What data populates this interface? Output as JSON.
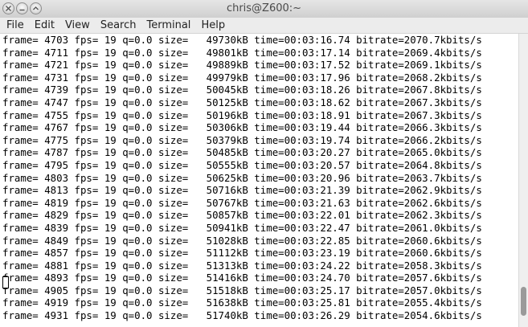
{
  "window": {
    "title": "chris@Z600:~"
  },
  "menu": [
    "File",
    "Edit",
    "View",
    "Search",
    "Terminal",
    "Help"
  ],
  "terminal": {
    "lines": [
      "frame= 4703 fps= 19 q=0.0 size=   49730kB time=00:03:16.74 bitrate=2070.7kbits/s",
      "frame= 4711 fps= 19 q=0.0 size=   49801kB time=00:03:17.14 bitrate=2069.4kbits/s",
      "frame= 4721 fps= 19 q=0.0 size=   49889kB time=00:03:17.52 bitrate=2069.1kbits/s",
      "frame= 4731 fps= 19 q=0.0 size=   49979kB time=00:03:17.96 bitrate=2068.2kbits/s",
      "frame= 4739 fps= 19 q=0.0 size=   50045kB time=00:03:18.26 bitrate=2067.8kbits/s",
      "frame= 4747 fps= 19 q=0.0 size=   50125kB time=00:03:18.62 bitrate=2067.3kbits/s",
      "frame= 4755 fps= 19 q=0.0 size=   50196kB time=00:03:18.91 bitrate=2067.3kbits/s",
      "frame= 4767 fps= 19 q=0.0 size=   50306kB time=00:03:19.44 bitrate=2066.3kbits/s",
      "frame= 4775 fps= 19 q=0.0 size=   50379kB time=00:03:19.74 bitrate=2066.2kbits/s",
      "frame= 4787 fps= 19 q=0.0 size=   50485kB time=00:03:20.27 bitrate=2065.0kbits/s",
      "frame= 4795 fps= 19 q=0.0 size=   50555kB time=00:03:20.57 bitrate=2064.8kbits/s",
      "frame= 4803 fps= 19 q=0.0 size=   50625kB time=00:03:20.96 bitrate=2063.7kbits/s",
      "frame= 4813 fps= 19 q=0.0 size=   50716kB time=00:03:21.39 bitrate=2062.9kbits/s",
      "frame= 4819 fps= 19 q=0.0 size=   50767kB time=00:03:21.63 bitrate=2062.6kbits/s",
      "frame= 4829 fps= 19 q=0.0 size=   50857kB time=00:03:22.01 bitrate=2062.3kbits/s",
      "frame= 4839 fps= 19 q=0.0 size=   50941kB time=00:03:22.47 bitrate=2061.0kbits/s",
      "frame= 4849 fps= 19 q=0.0 size=   51028kB time=00:03:22.85 bitrate=2060.6kbits/s",
      "frame= 4857 fps= 19 q=0.0 size=   51112kB time=00:03:23.19 bitrate=2060.6kbits/s",
      "frame= 4881 fps= 19 q=0.0 size=   51313kB time=00:03:24.22 bitrate=2058.3kbits/s",
      "frame= 4893 fps= 19 q=0.0 size=   51416kB time=00:03:24.70 bitrate=2057.6kbits/s",
      "frame= 4905 fps= 19 q=0.0 size=   51518kB time=00:03:25.17 bitrate=2057.0kbits/s",
      "frame= 4919 fps= 19 q=0.0 size=   51638kB time=00:03:25.81 bitrate=2055.4kbits/s",
      "frame= 4931 fps= 19 q=0.0 size=   51740kB time=00:03:26.29 bitrate=2054.6kbits/s"
    ]
  },
  "scroll": {
    "position": 0.97
  }
}
